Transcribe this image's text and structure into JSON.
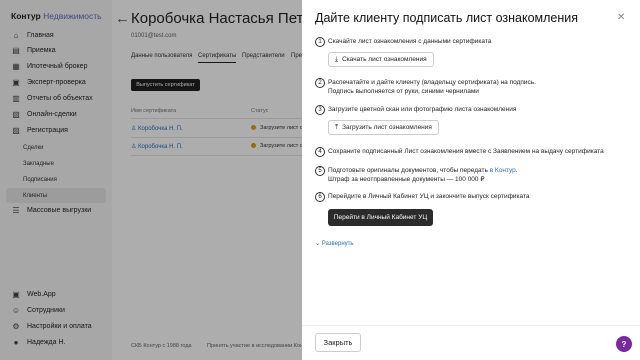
{
  "logo": {
    "part1": "Контур",
    "part2": "Недвижимость"
  },
  "sidebar": {
    "items": [
      {
        "label": "Главная",
        "icon": "home-icon",
        "glyph": "⌂"
      },
      {
        "label": "Приемка",
        "icon": "inbox-icon",
        "glyph": "▤"
      },
      {
        "label": "Ипотечный брокер",
        "icon": "calculator-icon",
        "glyph": "▦"
      },
      {
        "label": "Эксперт-проверка",
        "icon": "check-doc-icon",
        "glyph": "▣"
      },
      {
        "label": "Отчеты об объектах",
        "icon": "report-icon",
        "glyph": "▥"
      },
      {
        "label": "Онлайн-сделки",
        "icon": "deal-icon",
        "glyph": "▧"
      },
      {
        "label": "Регистрация",
        "icon": "registration-icon",
        "glyph": "▨"
      }
    ],
    "subitems": [
      "Сделки",
      "Закладные",
      "Подписания",
      "Клиенты"
    ],
    "bulk": {
      "label": "Массовые выгрузки",
      "glyph": "☰"
    },
    "bottom": [
      {
        "label": "Web.App",
        "glyph": "▣"
      },
      {
        "label": "Сотрудники",
        "glyph": "☺"
      },
      {
        "label": "Настройки и оплата",
        "glyph": "⚙"
      },
      {
        "label": "Надежда Н.",
        "glyph": "●"
      }
    ]
  },
  "main": {
    "title": "Коробочка Настасья Петро",
    "email": "01001@test.com",
    "tabs": [
      "Данные пользователя",
      "Сертификаты",
      "Представители",
      "Пре"
    ],
    "issue_button": "Выпустить сертификат",
    "columns": [
      "Имя сертификата",
      "Статус"
    ],
    "rows": [
      {
        "name": "Коробочка Н. П.",
        "status": "Загрузите лист о"
      },
      {
        "name": "Коробочка Н. П.",
        "status": "Загрузите лист о"
      }
    ],
    "footer_company": "СКБ Контур с 1988 года",
    "footer_research": "Принять участие в исследовании Кон"
  },
  "panel": {
    "title": "Дайте клиенту подписать лист ознакомления",
    "steps": [
      {
        "num": "1",
        "text": "Скачайте лист ознакомления с данными сертификата"
      },
      {
        "num": "2",
        "line1": "Распечатайте и дайте клиенту (владельцу сертификата) на подпись.",
        "line2": "Подпись выполняется от руки, синими чернилами"
      },
      {
        "num": "3",
        "text": "Загрузите цветной скан или фотографию листа ознакомления"
      },
      {
        "num": "4",
        "text": "Сохраните подписанный Лист ознакомления вместе с Заявлением на выдачу сертификата"
      },
      {
        "num": "5",
        "line1_a": "Подготовьте оригиналы документов, чтобы передать ",
        "line1_link": "в Контур",
        "line1_b": ".",
        "line2": "Штраф за неотправленные документы — 100 000 ₽"
      },
      {
        "num": "6",
        "text": "Перейдите в Личный Кабинет УЦ и закончите выпуск сертификата"
      }
    ],
    "download_button": "Скачать лист ознакомления",
    "upload_button": "Загрузить лист ознакомления",
    "cabinet_button": "Перейти в Личный Кабинет УЦ",
    "expand_link": "Развернуть",
    "close_button": "Закрыть",
    "help": "?"
  }
}
